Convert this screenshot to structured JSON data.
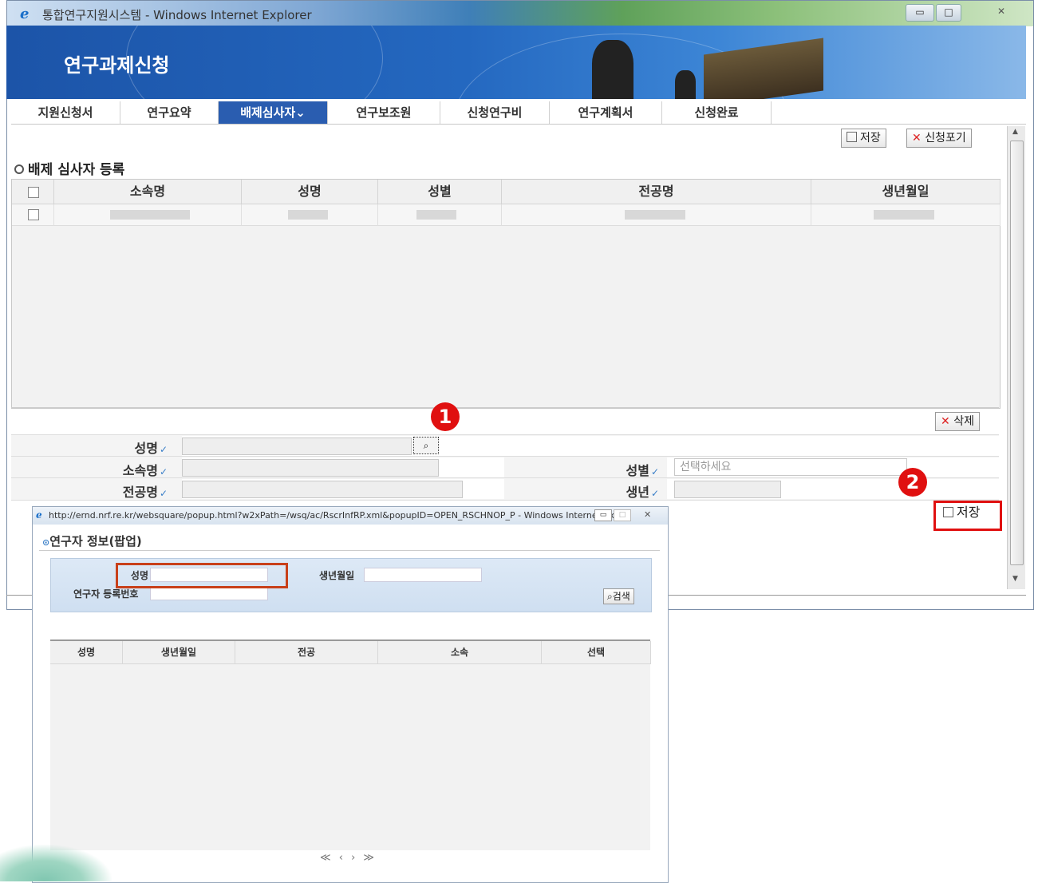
{
  "window": {
    "title": "통합연구지원시스템 - Windows Internet Explorer",
    "controls": {
      "minimize": "▭",
      "maximize": "□",
      "close": "✕"
    }
  },
  "banner": {
    "title": "연구과제신청"
  },
  "tabs": [
    {
      "label": "지원신청서"
    },
    {
      "label": "연구요약"
    },
    {
      "label": "배제심사자⌄",
      "active": true
    },
    {
      "label": "연구보조원"
    },
    {
      "label": "신청연구비"
    },
    {
      "label": "연구계획서"
    },
    {
      "label": "신청완료"
    }
  ],
  "toolbar": {
    "save_label": "저장",
    "cancel_label": "신청포기"
  },
  "section": {
    "title": "배제 심사자 등록"
  },
  "grid": {
    "columns": [
      "소속명",
      "성명",
      "성별",
      "전공명",
      "생년월일"
    ]
  },
  "delete_label": "삭제",
  "form": {
    "name_label": "성명",
    "affiliation_label": "소속명",
    "major_label": "전공명",
    "gender_label": "성별",
    "gender_placeholder": "선택하세요",
    "birth_label": "생년",
    "check": "✓"
  },
  "markers": {
    "one": "1",
    "two": "2"
  },
  "bottom_save_label": "저장",
  "popup": {
    "window_title": "http://ernd.nrf.re.kr/websquare/popup.html?w2xPath=/wsq/ac/RscrInfRP.xml&popupID=OPEN_RSCHNOP_P - Windows Internet Ex...",
    "heading": "연구자 정보(팝업)",
    "name_label": "성명",
    "birth_label": "생년월일",
    "reg_label": "연구자 등록번호",
    "search_label": "검색",
    "columns": [
      "성명",
      "생년월일",
      "전공",
      "소속",
      "선택"
    ],
    "pager": "≪ ‹ › ≫"
  },
  "colors": {
    "accent": "#2a5db0",
    "marker": "#e01010",
    "banner": "#1c54a8"
  }
}
